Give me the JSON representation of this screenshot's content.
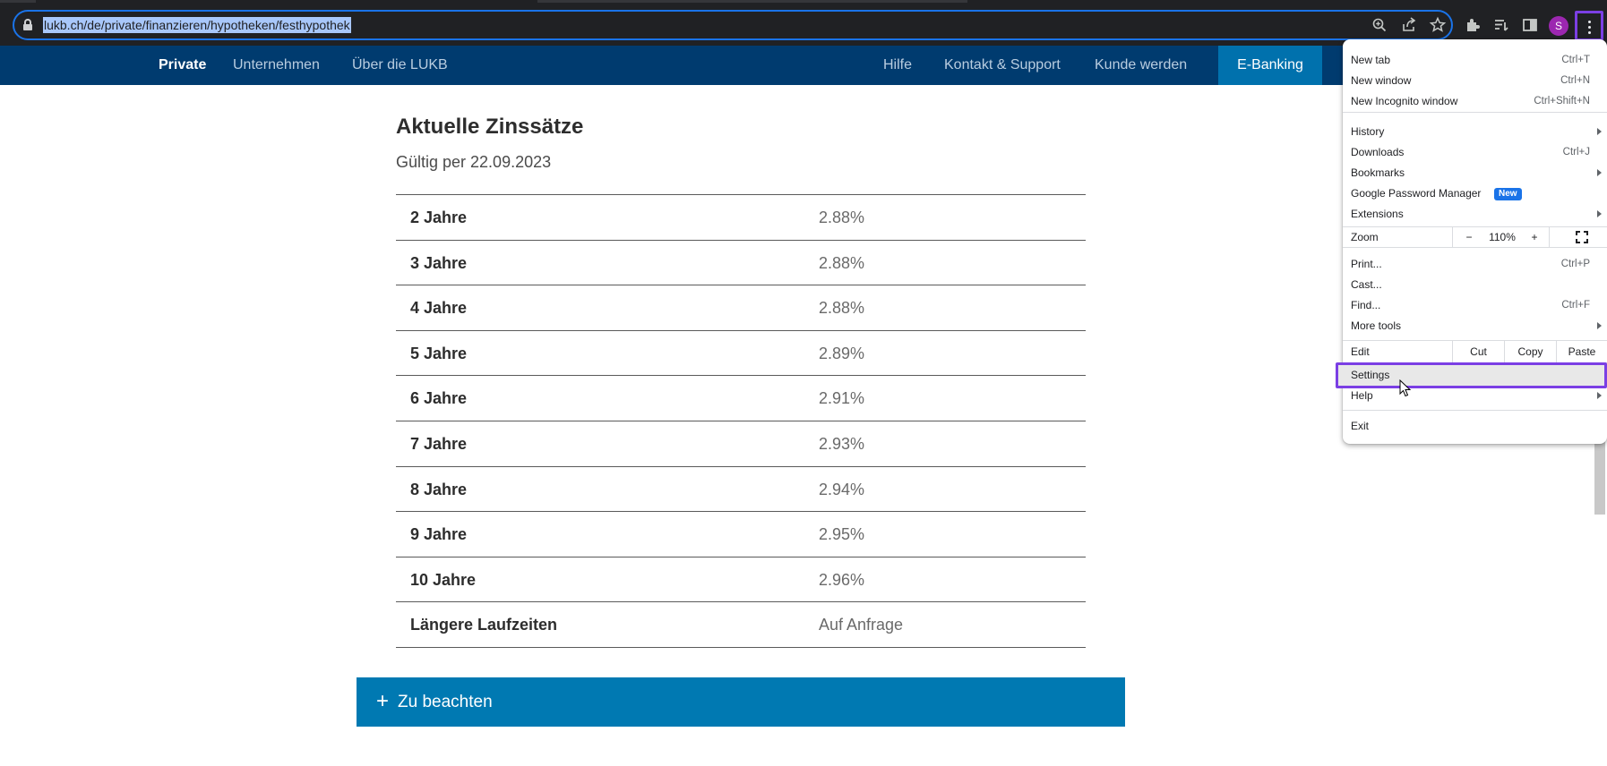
{
  "browser": {
    "url": "lukb.ch/de/private/finanzieren/hypotheken/festhypothek",
    "avatar_letter": "S",
    "icons": [
      "lock-icon",
      "zoom-icon",
      "share-icon",
      "star-icon",
      "extensions-icon",
      "reading-list-icon",
      "side-panel-icon",
      "menu-icon"
    ],
    "accent": "#1a73e8",
    "highlight": "#7b3fe4"
  },
  "nav": {
    "left": [
      "Private",
      "Unternehmen",
      "Über die LUKB"
    ],
    "right": [
      "Hilfe",
      "Kontakt & Support",
      "Kunde werden"
    ],
    "ebanking": "E-Banking",
    "background": "#003b6f"
  },
  "content": {
    "heading": "Aktuelle Zinssätze",
    "subtitle": "Gültig per 22.09.2023",
    "rates": [
      {
        "term": "2 Jahre",
        "rate": "2.88%"
      },
      {
        "term": "3 Jahre",
        "rate": "2.88%"
      },
      {
        "term": "4 Jahre",
        "rate": "2.88%"
      },
      {
        "term": "5 Jahre",
        "rate": "2.89%"
      },
      {
        "term": "6 Jahre",
        "rate": "2.91%"
      },
      {
        "term": "7 Jahre",
        "rate": "2.93%"
      },
      {
        "term": "8 Jahre",
        "rate": "2.94%"
      },
      {
        "term": "9 Jahre",
        "rate": "2.95%"
      },
      {
        "term": "10 Jahre",
        "rate": "2.96%"
      },
      {
        "term": "Längere Laufzeiten",
        "rate": "Auf Anfrage"
      }
    ],
    "accordion": {
      "plus": "+",
      "label": "Zu beachten",
      "color": "#0079b2"
    }
  },
  "menu": {
    "new_tab": {
      "label": "New tab",
      "shortcut": "Ctrl+T"
    },
    "new_window": {
      "label": "New window",
      "shortcut": "Ctrl+N"
    },
    "incognito": {
      "label": "New Incognito window",
      "shortcut": "Ctrl+Shift+N"
    },
    "history": {
      "label": "History"
    },
    "downloads": {
      "label": "Downloads",
      "shortcut": "Ctrl+J"
    },
    "bookmarks": {
      "label": "Bookmarks"
    },
    "passwords": {
      "label": "Google Password Manager",
      "badge": "New"
    },
    "extensions": {
      "label": "Extensions"
    },
    "zoom": {
      "label": "Zoom",
      "minus": "−",
      "value": "110%",
      "plus": "+"
    },
    "print": {
      "label": "Print...",
      "shortcut": "Ctrl+P"
    },
    "cast": {
      "label": "Cast..."
    },
    "find": {
      "label": "Find...",
      "shortcut": "Ctrl+F"
    },
    "more_tools": {
      "label": "More tools"
    },
    "edit": {
      "label": "Edit",
      "cut": "Cut",
      "copy": "Copy",
      "paste": "Paste"
    },
    "settings": {
      "label": "Settings"
    },
    "help": {
      "label": "Help"
    },
    "exit": {
      "label": "Exit"
    }
  }
}
